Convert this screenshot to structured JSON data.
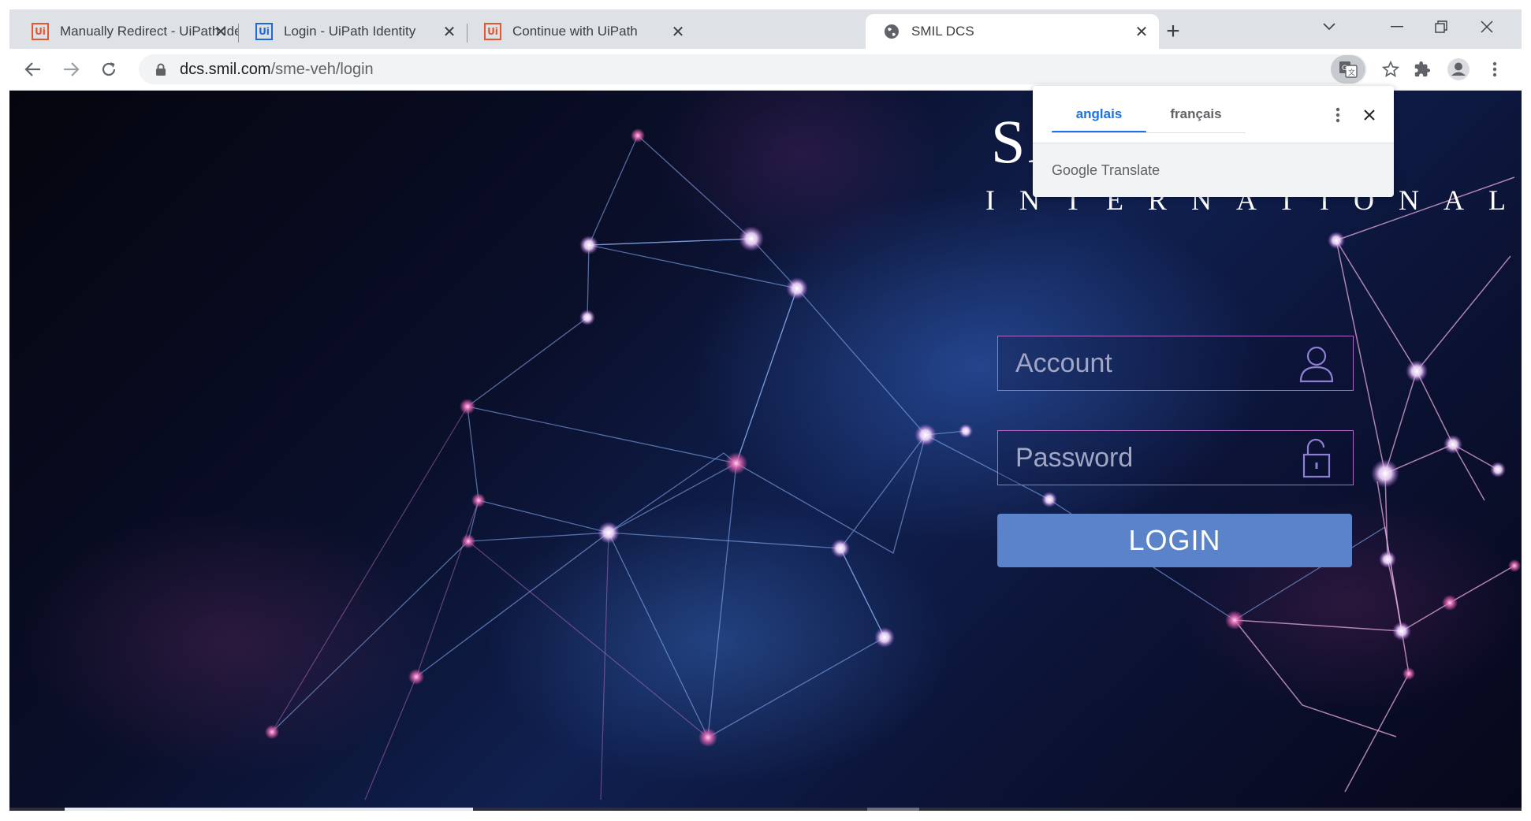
{
  "browser": {
    "tabs": [
      {
        "title": "Manually Redirect - UiPath Identi",
        "icon": "uipath-orange-icon",
        "active": false
      },
      {
        "title": "Login - UiPath Identity",
        "icon": "uipath-blue-icon",
        "active": false
      },
      {
        "title": "Continue with UiPath",
        "icon": "uipath-orange-icon",
        "active": false
      },
      {
        "title": "SMIL DCS",
        "icon": "globe-icon",
        "active": true
      }
    ],
    "new_tab_symbol": "+",
    "url_host": "dcs.smil.com",
    "url_path": "/sme-veh/login"
  },
  "page": {
    "brand_line1": "SA",
    "brand_line2": "INTERNATIONAL",
    "account_placeholder": "Account",
    "password_placeholder": "Password",
    "login_label": "LOGIN"
  },
  "translate_popup": {
    "tab_source": "anglais",
    "tab_target": "français",
    "footer_brand": "Google",
    "footer_product": "Translate"
  },
  "colors": {
    "uipath_orange": "#e5552e",
    "uipath_blue": "#1c6ad8",
    "login_button": "#5a83c9",
    "field_border": "#b06ac6",
    "translate_active": "#1a73e8"
  }
}
